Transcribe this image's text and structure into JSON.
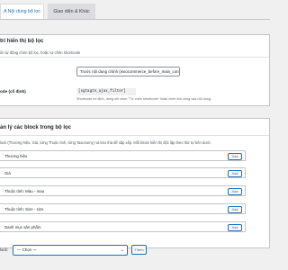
{
  "tabs": [
    {
      "label": "A Nội dung bộ lọc",
      "active": true
    },
    {
      "label": "Giao diện & Khác",
      "active": false
    }
  ],
  "position_section": {
    "title": "trí hiển thị bộ lọc",
    "description": "ổn tự động chèn bộ lọc, hoặc tự chèn shortcode",
    "position_select_value": "Trước nội dung chính (woocommerce_before_main_content)",
    "shortcode_label": "ode (cố định)",
    "shortcode_value": "[sgtagtn_ajax_filter]",
    "shortcode_help": "Shortcode cố định, dùng khi chọn \"Tự chèn shortcode\" hoặc chèn thủ công vào nội dung."
  },
  "blocks_section": {
    "title": "ản lý các block trong bộ lọc",
    "description": "lock (Thương hiệu, Giá, từng Thuộc tính, từng Taxonomy) và kéo thả để sắp xếp. Mỗi block hiển thị độc lập theo thứ tự bên dưới.",
    "blocks": [
      {
        "label": "Thương hiệu",
        "remove_label": "Xóa"
      },
      {
        "label": "Giá",
        "remove_label": "Xóa"
      },
      {
        "label": "Thuộc tính: Màu - mau",
        "remove_label": "Xóa"
      },
      {
        "label": "Thuộc tính: Size - size",
        "remove_label": "Xóa"
      },
      {
        "label": "Danh mục sản phẩm",
        "remove_label": "Xóa"
      }
    ],
    "add_label": "lock:",
    "add_select_value": "— Chọn —",
    "add_button_label": "Thêm"
  }
}
